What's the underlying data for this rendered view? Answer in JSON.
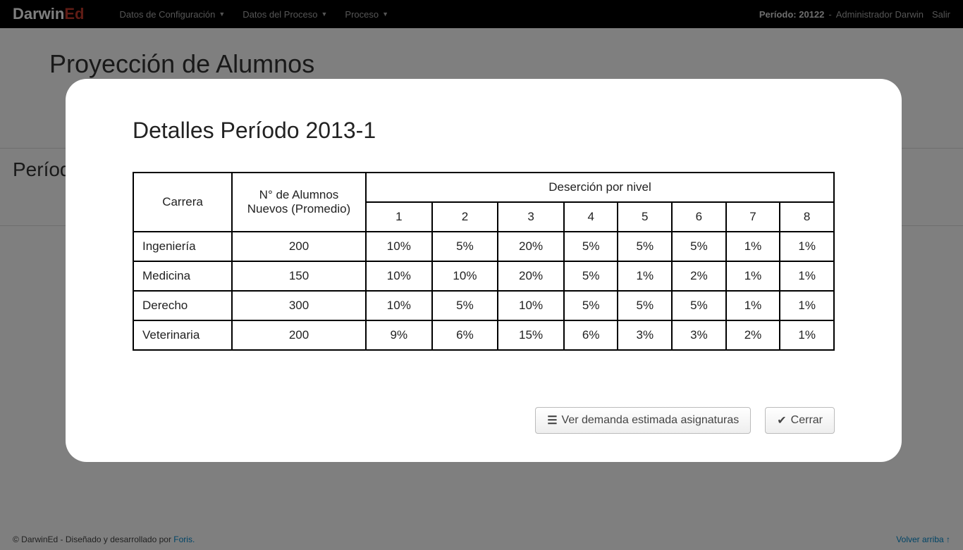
{
  "navbar": {
    "brand_prefix": "Darwin",
    "brand_suffix": "Ed",
    "menu": [
      "Datos de Configuración",
      "Datos del Proceso",
      "Proceso"
    ],
    "period_label": "Período: 20122",
    "user_label": "Administrador Darwin",
    "logout": "Salir"
  },
  "page": {
    "title": "Proyección de Alumnos",
    "period_side": "Período"
  },
  "modal": {
    "title": "Detalles Período 2013-1",
    "headers": {
      "carrera": "Carrera",
      "nuevos": "N° de Alumnos Nuevos (Promedio)",
      "desercion": "Deserción por nivel",
      "levels": [
        "1",
        "2",
        "3",
        "4",
        "5",
        "6",
        "7",
        "8"
      ]
    },
    "rows": [
      {
        "carrera": "Ingeniería",
        "nuevos": "200",
        "d": [
          "10%",
          "5%",
          "20%",
          "5%",
          "5%",
          "5%",
          "1%",
          "1%"
        ]
      },
      {
        "carrera": "Medicina",
        "nuevos": "150",
        "d": [
          "10%",
          "10%",
          "20%",
          "5%",
          "1%",
          "2%",
          "1%",
          "1%"
        ]
      },
      {
        "carrera": "Derecho",
        "nuevos": "300",
        "d": [
          "10%",
          "5%",
          "10%",
          "5%",
          "5%",
          "5%",
          "1%",
          "1%"
        ]
      },
      {
        "carrera": "Veterinaria",
        "nuevos": "200",
        "d": [
          "9%",
          "6%",
          "15%",
          "6%",
          "3%",
          "3%",
          "2%",
          "1%"
        ]
      }
    ],
    "btn_demanda": "Ver demanda estimada asignaturas",
    "btn_cerrar": "Cerrar"
  },
  "footer": {
    "copyright": "© DarwinEd - Diseñado y desarrollado por ",
    "company": "Foris.",
    "back_top": "Volver arriba ↑"
  }
}
